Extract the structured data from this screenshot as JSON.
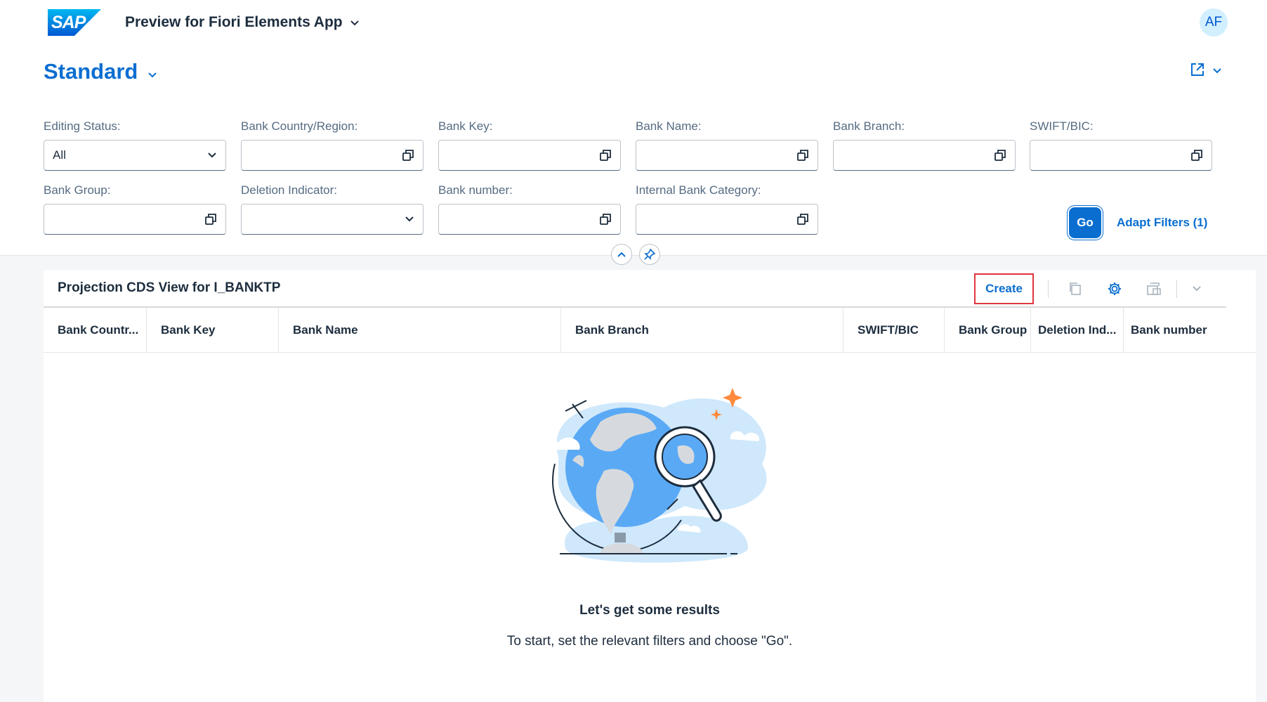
{
  "shell": {
    "app_title": "Preview for Fiori Elements App",
    "avatar": "AF",
    "logo_text": "SAP"
  },
  "header": {
    "variant": "Standard"
  },
  "filters": [
    {
      "label": "Editing Status:",
      "value": "All",
      "type": "select"
    },
    {
      "label": "Bank Country/Region:",
      "value": "",
      "type": "valuehelp"
    },
    {
      "label": "Bank Key:",
      "value": "",
      "type": "valuehelp"
    },
    {
      "label": "Bank Name:",
      "value": "",
      "type": "valuehelp"
    },
    {
      "label": "Bank Branch:",
      "value": "",
      "type": "valuehelp"
    },
    {
      "label": "SWIFT/BIC:",
      "value": "",
      "type": "valuehelp"
    },
    {
      "label": "Bank Group:",
      "value": "",
      "type": "valuehelp"
    },
    {
      "label": "Deletion Indicator:",
      "value": "",
      "type": "select"
    },
    {
      "label": "Bank number:",
      "value": "",
      "type": "valuehelp"
    },
    {
      "label": "Internal Bank Category:",
      "value": "",
      "type": "valuehelp"
    }
  ],
  "filterbar": {
    "go_label": "Go",
    "adapt_label": "Adapt Filters (1)"
  },
  "table": {
    "title": "Projection CDS View for I_BANKTP",
    "create_label": "Create",
    "columns": [
      "Bank Countr...",
      "Bank Key",
      "Bank Name",
      "Bank Branch",
      "SWIFT/BIC",
      "Bank Group",
      "Deletion Ind...",
      "Bank number"
    ],
    "empty_title": "Let's get some results",
    "empty_text": "To start, set the relevant filters and choose \"Go\"."
  },
  "colors": {
    "brand": "#0a6ed1",
    "highlight_border": "#e0363d"
  }
}
